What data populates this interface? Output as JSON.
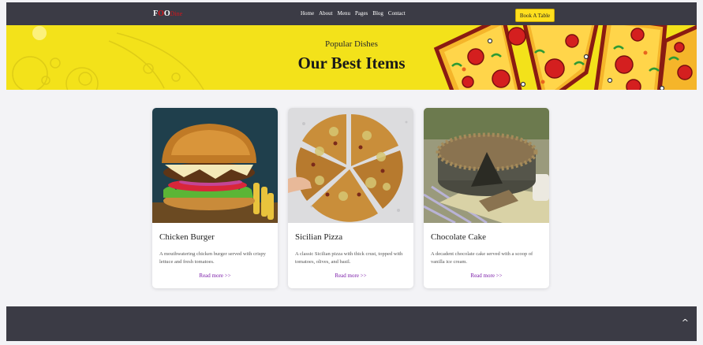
{
  "nav": {
    "logo": {
      "part1": "F",
      "part2": "O",
      "part3": "O",
      "rest": "Dine"
    },
    "links": [
      "Home",
      "About",
      "Menu",
      "Pages",
      "Blog",
      "Contact"
    ],
    "book_label": "Book A Table"
  },
  "hero": {
    "subtitle": "Popular Dishes",
    "title": "Our Best Items"
  },
  "cards": [
    {
      "name": "Chicken Burger",
      "desc": "A mouthwatering chicken burger served with crispy lettuce and fresh tomatoes.",
      "more": "Read more >>"
    },
    {
      "name": "Sicilian Pizza",
      "desc": "A classic Sicilian pizza with thick crust, topped with tomatoes, olives, and basil.",
      "more": "Read more >>"
    },
    {
      "name": "Chocolate Cake",
      "desc": "A decadent chocolate cake served with a scoop of vanilla ice cream.",
      "more": "Read more >>"
    }
  ],
  "footer": {
    "to_top": "^"
  },
  "colors": {
    "nav_bg": "#3b3b45",
    "hero_bg": "#f3e21a",
    "accent": "#ffdf1e",
    "link": "#7a1aa8",
    "logo_red": "#d8151b"
  }
}
